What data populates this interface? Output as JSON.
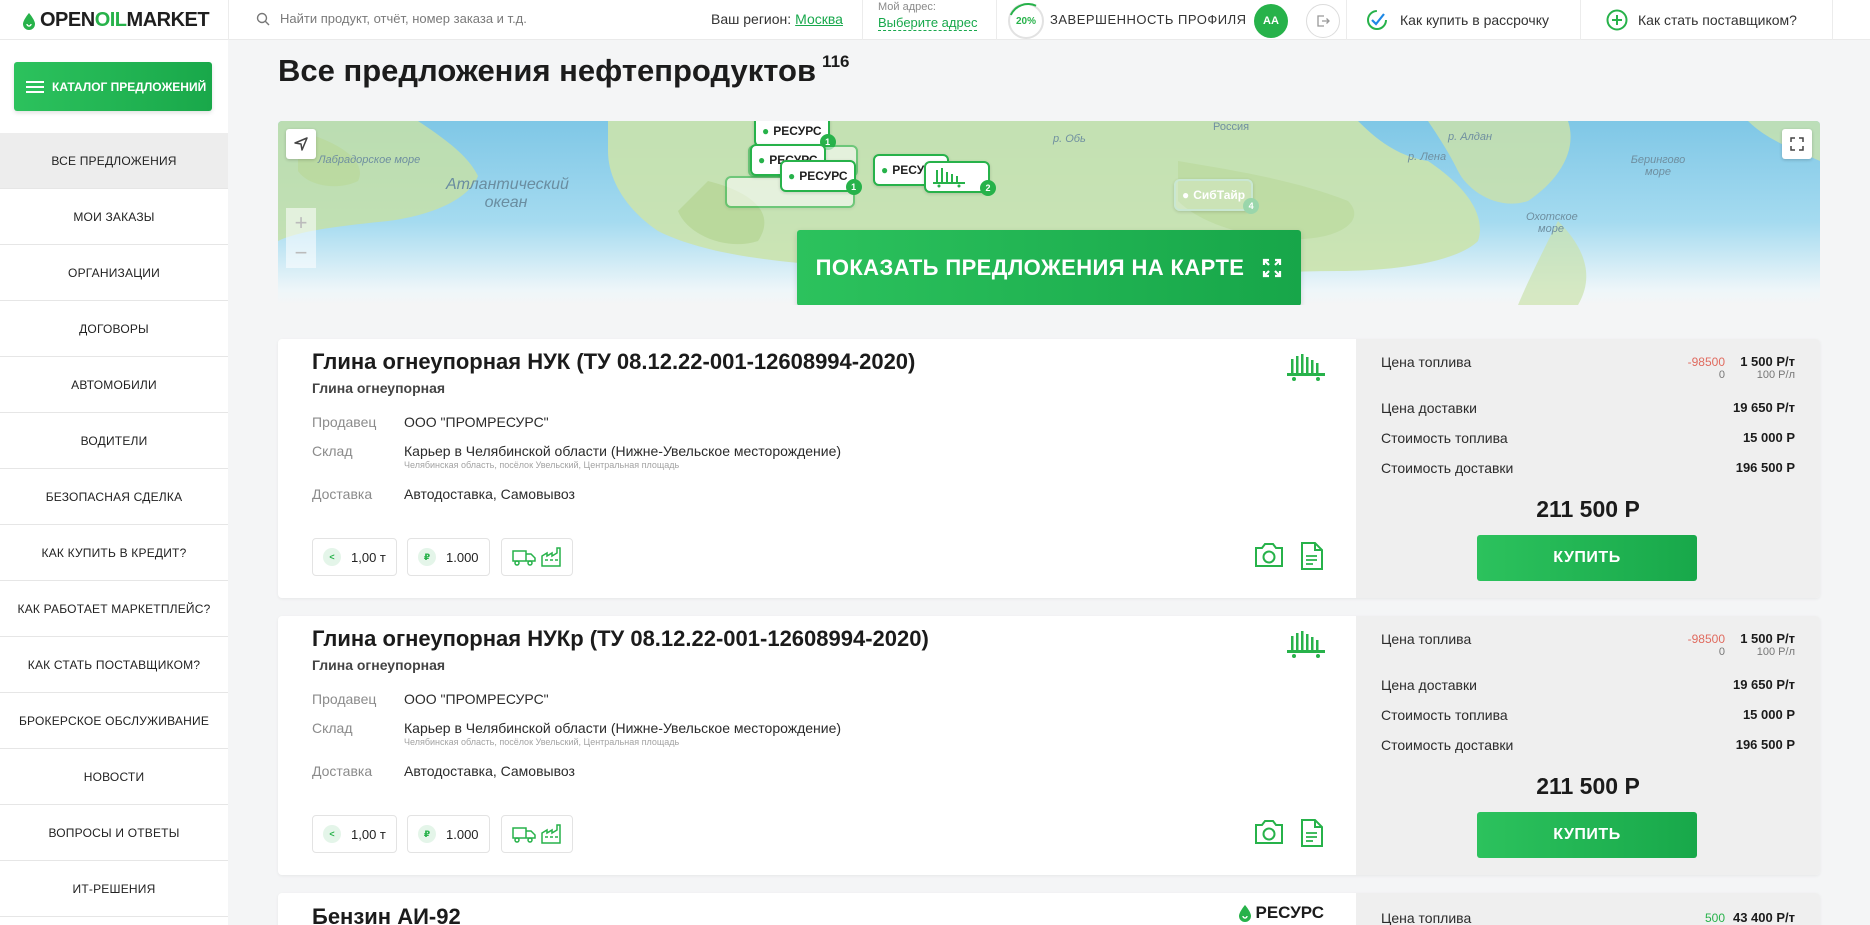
{
  "header": {
    "logo_open": "OPEN",
    "logo_oil": "OIL",
    "logo_market": "MARKET",
    "search_placeholder": "Найти продукт, отчёт, номер заказа и т.д.",
    "region_label": "Ваш регион:",
    "region_value": "Москва",
    "my_address_label": "Мой адрес:",
    "my_address_value": "Выберите адрес",
    "profile_progress": "20%",
    "profile_label": "ЗАВЕРШЕННОСТЬ ПРОФИЛЯ",
    "avatar_initials": "АА",
    "installment_link": "Как купить в рассрочку",
    "supplier_link": "Как стать поставщиком?"
  },
  "sidebar": {
    "catalog_button": "КАТАЛОГ ПРЕДЛОЖЕНИЙ",
    "items": [
      {
        "label": "ВСЕ ПРЕДЛОЖЕНИЯ",
        "active": true
      },
      {
        "label": "МОИ ЗАКАЗЫ"
      },
      {
        "label": "ОРГАНИЗАЦИИ"
      },
      {
        "label": "ДОГОВОРЫ"
      },
      {
        "label": "АВТОМОБИЛИ"
      },
      {
        "label": "ВОДИТЕЛИ"
      },
      {
        "label": "БЕЗОПАСНАЯ СДЕЛКА"
      },
      {
        "label": "КАК КУПИТЬ В КРЕДИТ?"
      },
      {
        "label": "КАК РАБОТАЕТ МАРКЕТПЛЕЙС?"
      },
      {
        "label": "КАК СТАТЬ ПОСТАВЩИКОМ?"
      },
      {
        "label": "БРОКЕРСКОЕ ОБСЛУЖИВАНИЕ"
      },
      {
        "label": "НОВОСТИ"
      },
      {
        "label": "ВОПРОСЫ И ОТВЕТЫ"
      },
      {
        "label": "ИТ-РЕШЕНИЯ"
      }
    ]
  },
  "page": {
    "title": "Все предложения нефтепродуктов",
    "count": "116"
  },
  "map": {
    "labels": {
      "atlantic": "Атлантический океан",
      "labrador": "Лабрадорское море",
      "bering": "Берингово море",
      "okhotsk": "Охотское море",
      "russia": "Россия",
      "ob": "р. Обь",
      "lena": "р. Лена",
      "aldan": "р. Алдан"
    },
    "markers": [
      {
        "text": "РЕСУРС",
        "count": "1"
      },
      {
        "text": "РЕСУРС",
        "count": "1"
      },
      {
        "text": "РЕСУРС",
        "count": "1"
      },
      {
        "text": "РЕСУРС",
        "count": "1"
      },
      {
        "text": "СибТайр",
        "count": "4"
      },
      {
        "text": "",
        "count": "2"
      }
    ],
    "zoom_in": "+",
    "zoom_out": "−",
    "cta": "ПОКАЗАТЬ ПРЕДЛОЖЕНИЯ НА КАРТЕ"
  },
  "offers": [
    {
      "title": "Глина огнеупорная НУК (ТУ 08.12.22-001-12608994-2020)",
      "subtitle": "Глина огнеупорная",
      "seller_label": "Продавец",
      "seller": "ООО \"ПРОМРЕСУРС\"",
      "warehouse_label": "Склад",
      "warehouse": "Карьер в Челябинской области (Нижне-Увельское месторождение)",
      "warehouse_address": "Челябинская область, посёлок Увельский, Центральная площадь",
      "delivery_label": "Доставка",
      "delivery": "Автодоставка, Самовывоз",
      "min_volume": "1,00 т",
      "min_price": "1.000",
      "fuel_price_label": "Цена топлива",
      "fuel_discount": "-98500",
      "fuel_price_t": "1 500 Р/т",
      "fuel_discount_l": "0",
      "fuel_price_l": "100 Р/л",
      "delivery_price_label": "Цена доставки",
      "delivery_price": "19 650 Р/т",
      "fuel_cost_label": "Стоимость топлива",
      "fuel_cost": "15 000 Р",
      "delivery_cost_label": "Стоимость доставки",
      "delivery_cost": "196 500 Р",
      "total": "211 500 Р",
      "buy": "КУПИТЬ"
    },
    {
      "title": "Глина огнеупорная НУКр (ТУ 08.12.22-001-12608994-2020)",
      "subtitle": "Глина огнеупорная",
      "seller_label": "Продавец",
      "seller": "ООО \"ПРОМРЕСУРС\"",
      "warehouse_label": "Склад",
      "warehouse": "Карьер в Челябинской области (Нижне-Увельское месторождение)",
      "warehouse_address": "Челябинская область, посёлок Увельский, Центральная площадь",
      "delivery_label": "Доставка",
      "delivery": "Автодоставка, Самовывоз",
      "min_volume": "1,00 т",
      "min_price": "1.000",
      "fuel_price_label": "Цена топлива",
      "fuel_discount": "-98500",
      "fuel_price_t": "1 500 Р/т",
      "fuel_discount_l": "0",
      "fuel_price_l": "100 Р/л",
      "delivery_price_label": "Цена доставки",
      "delivery_price": "19 650 Р/т",
      "fuel_cost_label": "Стоимость топлива",
      "fuel_cost": "15 000 Р",
      "delivery_cost_label": "Стоимость доставки",
      "delivery_cost": "196 500 Р",
      "total": "211 500 Р",
      "buy": "КУПИТЬ"
    },
    {
      "title": "Бензин АИ-92",
      "brand": "РЕСУРС",
      "fuel_price_label": "Цена топлива",
      "fuel_discount": "500",
      "fuel_price_t": "43 400 Р/т"
    }
  ],
  "colors": {
    "brand_green": "#27b24a",
    "discount_red": "#e06b5f"
  },
  "icons": [
    "search-icon",
    "logout-icon",
    "checkmark-circle-icon",
    "plus-circle-icon",
    "menu-icon",
    "locate-arrow-icon",
    "expand-icon",
    "truck-icon",
    "factory-icon",
    "camera-icon",
    "document-icon",
    "railcar-icon",
    "ruble-icon"
  ]
}
